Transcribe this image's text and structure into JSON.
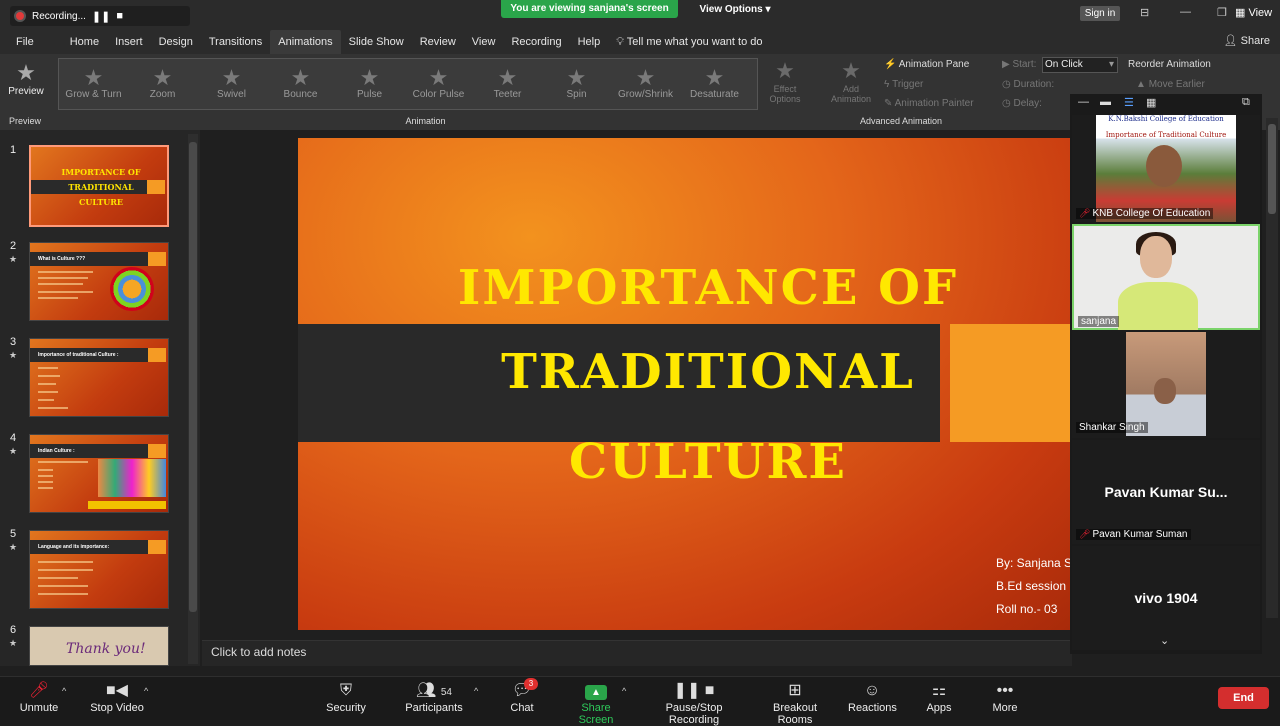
{
  "zoom_top": {
    "recording": "Recording...",
    "viewing_banner": "You are viewing sanjana's screen",
    "view_options": "View Options",
    "view": "View",
    "sign_in": "Sign in"
  },
  "ribbon": {
    "tabs": [
      "File",
      "Home",
      "Insert",
      "Design",
      "Transitions",
      "Animations",
      "Slide Show",
      "Review",
      "View",
      "Recording",
      "Help"
    ],
    "tell_me": "Tell me what you want to do",
    "share": "Share",
    "preview": "Preview",
    "preview_group": "Preview",
    "animations": [
      "Grow & Turn",
      "Zoom",
      "Swivel",
      "Bounce",
      "Pulse",
      "Color Pulse",
      "Teeter",
      "Spin",
      "Grow/Shrink",
      "Desaturate"
    ],
    "effect_options_1": "Effect",
    "effect_options_2": "Options",
    "add_animation_1": "Add",
    "add_animation_2": "Animation",
    "animation_group": "Animation",
    "animation_pane": "Animation Pane",
    "trigger": "Trigger",
    "animation_painter": "Animation Painter",
    "advanced_group": "Advanced Animation",
    "start_label": "Start:",
    "start_value": "On Click",
    "duration_label": "Duration:",
    "delay_label": "Delay:",
    "reorder": "Reorder Animation",
    "move_earlier": "Move Earlier"
  },
  "thumbnails": {
    "numbers": [
      "1",
      "2",
      "3",
      "4",
      "5",
      "6"
    ],
    "slide1_title": [
      "IMPORTANCE OF",
      "TRADITIONAL",
      "CULTURE"
    ],
    "slide2_title": "What is Culture ???",
    "slide3_title": "Importance of traditional Culture :",
    "slide4_title": "Indian Culture :",
    "slide5_title": "Language and its importance:",
    "slide6_text": "Thank you!"
  },
  "slide": {
    "line1": "IMPORTANCE OF",
    "line2": "TRADITIONAL",
    "line3": "CULTURE",
    "by": "By: Sanjana S",
    "session": "B.Ed session",
    "roll": "Roll no.- 03"
  },
  "notes_placeholder": "Click to add notes",
  "participants_panel": {
    "tile1_name": "KNB College Of Education",
    "tile1_header1": "K.N.Bakshi College of Education",
    "tile1_header2": "Importance of Traditional Culture",
    "tile2_name": "sanjana",
    "tile3_name": "Shankar Singh",
    "tile4_big": "Pavan Kumar Su...",
    "tile4_name": "Pavan Kumar Suman",
    "tile5_big": "vivo 1904"
  },
  "bottom_bar": {
    "unmute": "Unmute",
    "stop_video": "Stop Video",
    "security": "Security",
    "participants": "Participants",
    "participants_count": "54",
    "chat": "Chat",
    "chat_badge": "3",
    "share_screen": "Share Screen",
    "pause_recording": "Pause/Stop Recording",
    "breakout": "Breakout Rooms",
    "reactions": "Reactions",
    "apps": "Apps",
    "more": "More",
    "end": "End"
  }
}
